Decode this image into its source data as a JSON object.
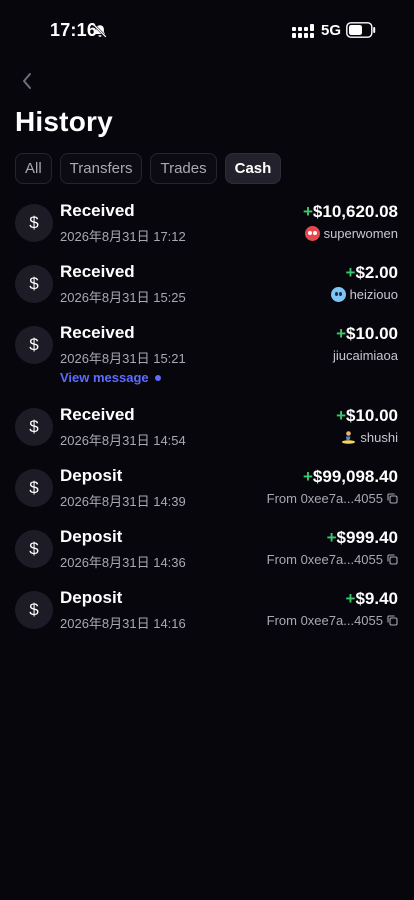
{
  "status_bar": {
    "time": "17:16",
    "network": "5G",
    "icons": [
      "bell-muted-icon",
      "signal-icon",
      "battery-icon"
    ]
  },
  "header": {
    "back_icon": "chevron-left-icon",
    "title": "History"
  },
  "tabs": [
    {
      "label": "All",
      "active": false
    },
    {
      "label": "Transfers",
      "active": false
    },
    {
      "label": "Trades",
      "active": false
    },
    {
      "label": "Cash",
      "active": true
    }
  ],
  "colors": {
    "background": "#07060d",
    "positive": "#39c96b",
    "link": "#5b6cff"
  },
  "transactions": [
    {
      "title": "Received",
      "date": "2026年8月31日 17:12",
      "sign": "+",
      "amount": "$10,620.08",
      "party": "superwomen",
      "party_icon": "red-avatar-icon"
    },
    {
      "title": "Received",
      "date": "2026年8月31日 15:25",
      "sign": "+",
      "amount": "$2.00",
      "party": "heiziouo",
      "party_icon": "blue-avatar-icon"
    },
    {
      "title": "Received",
      "date": "2026年8月31日 15:21",
      "sign": "+",
      "amount": "$10.00",
      "party": "jiucaimiaoa",
      "link": "View message"
    },
    {
      "title": "Received",
      "date": "2026年8月31日 14:54",
      "sign": "+",
      "amount": "$10.00",
      "party": "shushi",
      "party_icon": "surfer-avatar-icon"
    },
    {
      "title": "Deposit",
      "date": "2026年8月31日 14:39",
      "sign": "+",
      "amount": "$99,098.40",
      "party": "From 0xee7a...4055",
      "party_icon": "copy-icon"
    },
    {
      "title": "Deposit",
      "date": "2026年8月31日 14:36",
      "sign": "+",
      "amount": "$999.40",
      "party": "From 0xee7a...4055",
      "party_icon": "copy-icon"
    },
    {
      "title": "Deposit",
      "date": "2026年8月31日 14:16",
      "sign": "+",
      "amount": "$9.40",
      "party": "From 0xee7a...4055",
      "party_icon": "copy-icon"
    }
  ],
  "row_icon": "dollar-icon",
  "dollar_glyph": "$"
}
